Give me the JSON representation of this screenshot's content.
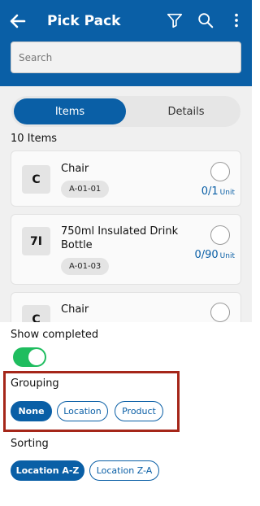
{
  "header": {
    "title": "Pick Pack",
    "back_icon": "arrow-left-icon",
    "filter_icon": "filter-icon",
    "search_icon": "search-icon",
    "more_icon": "more-vertical-icon",
    "color": "#0a5fa6"
  },
  "search": {
    "placeholder": "Search"
  },
  "tabs": {
    "items": "Items",
    "details": "Details"
  },
  "item_count": "10 Items",
  "items": [
    {
      "avatar": "C",
      "name": "Chair",
      "location": "A-01-01",
      "qty": "0/1",
      "unit": "Unit"
    },
    {
      "avatar": "7I",
      "name": "750ml Insulated Drink Bottle",
      "location": "A-01-03",
      "qty": "0/90",
      "unit": "Unit"
    },
    {
      "avatar": "C",
      "name": "Chair"
    }
  ],
  "sheet": {
    "show_completed_label": "Show completed",
    "show_completed_on": true,
    "grouping_label": "Grouping",
    "grouping_options": [
      "None",
      "Location",
      "Product"
    ],
    "grouping_selected": "None",
    "sorting_label": "Sorting",
    "sorting_options": [
      "Location A-Z",
      "Location Z-A"
    ],
    "sorting_selected": "Location A-Z"
  }
}
